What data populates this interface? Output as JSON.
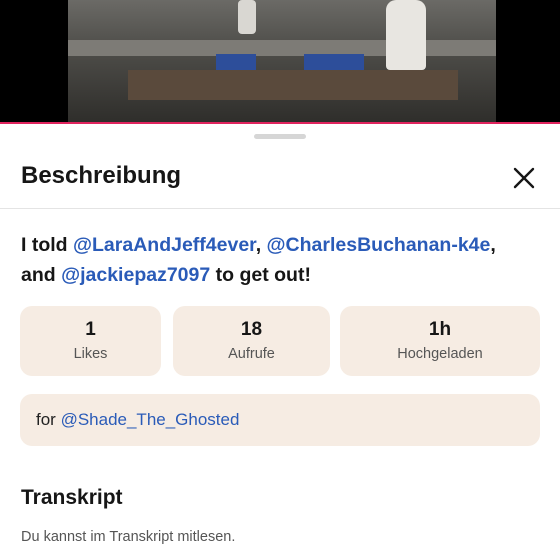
{
  "sheet": {
    "title": "Beschreibung"
  },
  "caption": {
    "prefix": "I told ",
    "mention1": "@LaraAndJeff4ever",
    "sep1": ",",
    "mention2": "@CharlesBuchanan-k4e",
    "sep2": ",",
    "and_word": "and ",
    "mention3": "@jackiepaz7097",
    "suffix": " to get out!"
  },
  "stats": [
    {
      "value": "1",
      "label": "Likes"
    },
    {
      "value": "18",
      "label": "Aufrufe"
    },
    {
      "value": "1h",
      "label": "Hochgeladen"
    }
  ],
  "for_box": {
    "prefix": "for ",
    "mention": "@Shade_The_Ghosted"
  },
  "transcript": {
    "title": "Transkript",
    "subtitle": "Du kannst im Transkript mitlesen."
  },
  "colors": {
    "mention": "#2a5bb8",
    "card_bg": "#f6ece3",
    "progress": "#e0245e"
  },
  "icons": {
    "close": "close-icon"
  }
}
